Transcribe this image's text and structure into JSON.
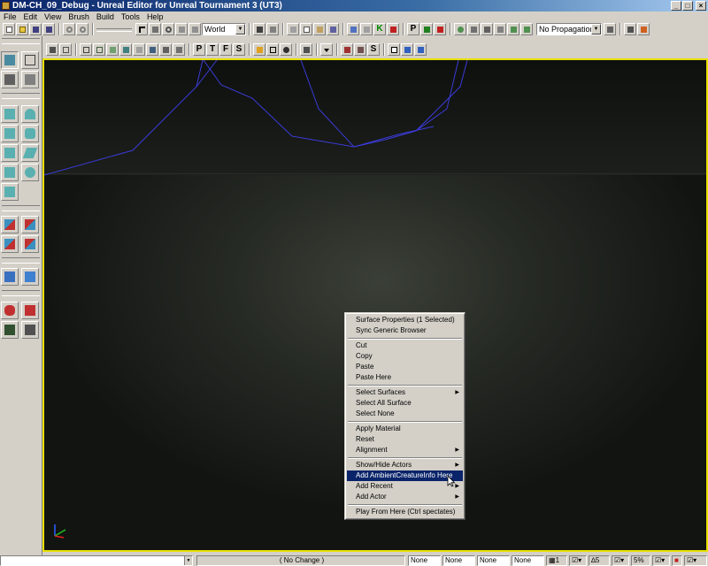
{
  "window": {
    "title": "DM-CH_09_Debug - Unreal Editor for Unreal Tournament 3 (UT3)"
  },
  "menubar": [
    "File",
    "Edit",
    "View",
    "Brush",
    "Build",
    "Tools",
    "Help"
  ],
  "toolbar": {
    "coord_system": "World",
    "propagation": "No Propagation",
    "view_letters": [
      "P",
      "T",
      "F",
      "S"
    ],
    "extra_letters": [
      "K",
      "P",
      "S"
    ]
  },
  "context_menu": {
    "items": [
      {
        "label": "Surface Properties (1 Selected)"
      },
      {
        "label": "Sync Generic Browser"
      },
      {
        "sep": true
      },
      {
        "label": "Cut"
      },
      {
        "label": "Copy"
      },
      {
        "label": "Paste"
      },
      {
        "label": "Paste Here"
      },
      {
        "sep": true
      },
      {
        "label": "Select Surfaces",
        "submenu": true
      },
      {
        "label": "Select All Surface"
      },
      {
        "label": "Select None"
      },
      {
        "sep": true
      },
      {
        "label": "Apply Material"
      },
      {
        "label": "Reset"
      },
      {
        "label": "Alignment",
        "submenu": true
      },
      {
        "sep": true
      },
      {
        "label": "Show/Hide Actors",
        "submenu": true
      },
      {
        "label": "Add AmbientCreatureInfo Here",
        "highlighted": true
      },
      {
        "label": "Add Recent",
        "submenu": true
      },
      {
        "label": "Add Actor",
        "submenu": true
      },
      {
        "sep": true
      },
      {
        "label": "Play From Here (Ctrl spectates)"
      }
    ]
  },
  "statusbar": {
    "status": "( No Change )",
    "fields": [
      "None",
      "None",
      "None",
      "None"
    ],
    "grid": "1",
    "rotation_snap": "5",
    "scale_snap": "5%"
  },
  "colors": {
    "viewport_border": "#e8e000",
    "wire": "#3b3bd8",
    "highlight": "#0a246a"
  }
}
